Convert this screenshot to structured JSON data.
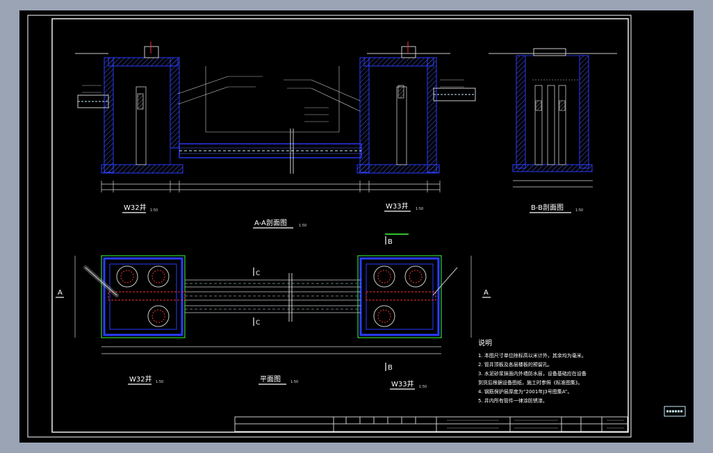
{
  "drawing": {
    "w32_label": "W32井",
    "w33_label": "W33井",
    "scale_1_50": "1:50",
    "section_aa_title": "A-A剖面图",
    "section_bb_title": "B-B剖面图",
    "plan_title": "平面图",
    "section_mark_a": "A",
    "section_mark_b": "B",
    "section_mark_c": "C"
  },
  "notes": {
    "heading": "说明",
    "items": [
      "1. 本图尺寸单位除标高以米计外，其余均为毫米。",
      "2. 管井顶板及各层楼板的预留孔。",
      "3. 水泥砂浆抹面内外墙防水层，设备基础应在设备",
      "   到货后根据设备图纸，施工时参照《标准图集》。",
      "4. 钢筋保护层厚度为“2001年J3号图集A”。",
      "5. 井内所有管件一律涂防锈漆。"
    ]
  },
  "colors": {
    "background": "#000000",
    "frame": "#ffffff",
    "wall_blue": "#2a3dff",
    "hatch": "#4a5cff",
    "pipe_cyan": "#c8f0ff",
    "dim": "#d8d8d8",
    "red": "#ff3030",
    "green": "#3cff3c",
    "yellow": "#ffff40"
  }
}
